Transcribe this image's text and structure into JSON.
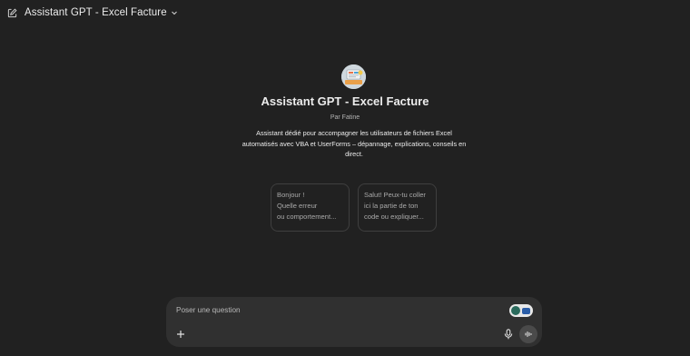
{
  "header": {
    "title": "Assistant GPT - Excel Facture",
    "new_chat_icon": "edit-icon",
    "dropdown_icon": "chevron-down-icon"
  },
  "hero": {
    "title": "Assistant GPT - Excel Facture",
    "author": "Par Fatine",
    "description": "Assistant dédié pour accompagner les utilisateurs de fichiers Excel automatisés avec VBA et UserForms – dépannage, explications, conseils en direct."
  },
  "suggestions": [
    {
      "lines": [
        "Bonjour !",
        "Quelle erreur",
        "ou comportement..."
      ]
    },
    {
      "lines": [
        "Salut! Peux-tu coller",
        "ici la partie de ton",
        "code ou expliquer..."
      ]
    }
  ],
  "composer": {
    "placeholder": "Poser une question",
    "icons": [
      "plus-icon",
      "microphone-icon",
      "voice-mode-icon"
    ]
  },
  "colors": {
    "background": "#212121",
    "composer": "#303030",
    "card_border": "#3f3f3f"
  }
}
